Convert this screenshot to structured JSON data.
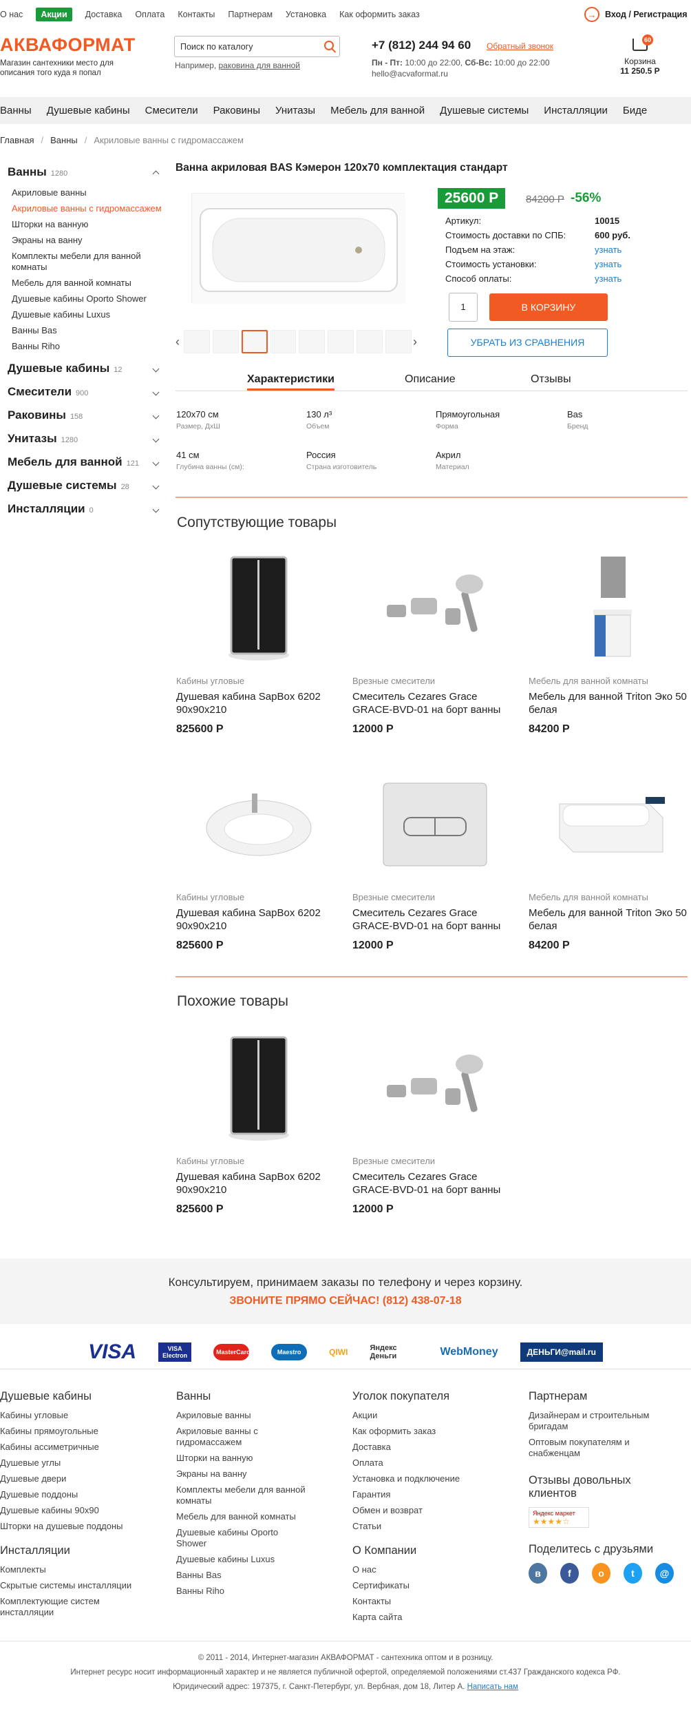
{
  "topnav": {
    "items": [
      "О нас",
      "Акции",
      "Доставка",
      "Оплата",
      "Контакты",
      "Партнерам",
      "Установка",
      "Как оформить заказ"
    ],
    "login": "Вход / Регистрация"
  },
  "header": {
    "logo": "АКВАФОРМАТ",
    "tagline": "Магазин сантехники место для описания того куда я попал",
    "search_placeholder": "Поиск по каталогу",
    "example_prefix": "Например, ",
    "example_link": "раковина для ванной",
    "phone": "+7 (812) 244 94 60",
    "callback": "Обратный звонок",
    "hours_weekday_label": "Пн - Пт:",
    "hours_weekday": "10:00 до 22:00,",
    "hours_weekend_label": "Сб-Вс:",
    "hours_weekend": "10:00 до 22:00",
    "email": "hello@acvaformat.ru",
    "cart_label": "Корзина",
    "cart_sum": "11 250.5 Р",
    "cart_count": "60"
  },
  "catnav": [
    "Ванны",
    "Душевые кабины",
    "Смесители",
    "Раковины",
    "Унитазы",
    "Мебель для ванной",
    "Душевые системы",
    "Инсталляции",
    "Биде"
  ],
  "breadcrumb": [
    "Главная",
    "Ванны",
    "Акриловые ванны с гидромассажем"
  ],
  "sidebar": [
    {
      "label": "Ванны",
      "count": "1280",
      "open": true,
      "subs": [
        "Акриловые ванны",
        "Акриловые ванны с гидромассажем",
        "Шторки на ванную",
        "Экраны на ванну",
        "Комплекты мебели для ванной комнаты",
        "Мебель для ванной комнаты",
        "Душевые кабины Oporto Shower",
        "Душевые кабины Luxus",
        "Ванны Bas",
        "Ванны Riho"
      ]
    },
    {
      "label": "Душевые кабины",
      "count": "12"
    },
    {
      "label": "Смесители",
      "count": "900"
    },
    {
      "label": "Раковины",
      "count": "158"
    },
    {
      "label": "Унитазы",
      "count": "1280"
    },
    {
      "label": "Мебель для ванной",
      "count": "121"
    },
    {
      "label": "Душевые системы",
      "count": "28"
    },
    {
      "label": "Инсталляции",
      "count": "0"
    }
  ],
  "product": {
    "title": "Ванна акриловая BAS Кэмерон 120x70 комплектация стандарт",
    "price": "25600 Р",
    "old_price": "84200 Р",
    "discount": "-56%",
    "specs": [
      {
        "k": "Артикул:",
        "v": "10015"
      },
      {
        "k": "Стоимость доставки по СПБ:",
        "v": "600 руб."
      },
      {
        "k": "Подъем на этаж:",
        "v": "узнать"
      },
      {
        "k": "Стоимость установки:",
        "v": "узнать"
      },
      {
        "k": "Способ оплаты:",
        "v": "узнать"
      }
    ],
    "qty": "1",
    "buy": "В КОРЗИНУ",
    "compare": "УБРАТЬ ИЗ СРАВНЕНИЯ",
    "tabs": [
      "Характеристики",
      "Описание",
      "Отзывы"
    ],
    "attrs": [
      {
        "v": "120x70 см",
        "l": "Размер, ДхШ"
      },
      {
        "v": "130 л³",
        "l": "Объем"
      },
      {
        "v": "Прямоугольная",
        "l": "Форма"
      },
      {
        "v": "Bas",
        "l": "Бренд"
      },
      {
        "v": "41 см",
        "l": "Глубина ванны (см):"
      },
      {
        "v": "Россия",
        "l": "Страна изготовитель"
      },
      {
        "v": "Акрил",
        "l": "Материал"
      }
    ]
  },
  "related": {
    "title": "Сопутствующие товары",
    "items": [
      {
        "cat": "Кабины угловые",
        "name": "Душевая кабина SapBox 6202 90x90x210",
        "price": "825600 Р"
      },
      {
        "cat": "Врезные смесители",
        "name": "Смеситель Cezares Grace GRACE-BVD-01 на борт ванны",
        "price": "12000 Р"
      },
      {
        "cat": "Мебель для ванной комнаты",
        "name": "Мебель для ванной Triton Эко 50 белая",
        "price": "84200 Р"
      },
      {
        "cat": "Кабины угловые",
        "name": "Душевая кабина SapBox 6202 90x90x210",
        "price": "825600 Р"
      },
      {
        "cat": "Врезные смесители",
        "name": "Смеситель Cezares Grace GRACE-BVD-01 на борт ванны",
        "price": "12000 Р"
      },
      {
        "cat": "Мебель для ванной комнаты",
        "name": "Мебель для ванной Triton Эко 50 белая",
        "price": "84200 Р"
      }
    ]
  },
  "similar": {
    "title": "Похожие товары",
    "items": [
      {
        "cat": "Кабины угловые",
        "name": "Душевая кабина SapBox 6202 90x90x210",
        "price": "825600 Р"
      },
      {
        "cat": "Врезные смесители",
        "name": "Смеситель Cezares Grace GRACE-BVD-01 на борт ванны",
        "price": "12000 Р"
      }
    ]
  },
  "consult": {
    "line1": "Консультируем, принимаем заказы по телефону и через корзину.",
    "line2": "ЗВОНИТЕ ПРЯМО СЕЙЧАС! (812) 438-07-18"
  },
  "payments": [
    "VISA",
    "VISA Electron",
    "MasterCard",
    "Maestro",
    "QIWI",
    "Яндекс Деньги",
    "WebMoney",
    "ДЕНЬГИ@mail.ru"
  ],
  "footer": {
    "col1": {
      "title": "Душевые кабины",
      "items": [
        "Кабины угловые",
        "Кабины прямоугольные",
        "Кабины ассиметричные",
        "Душевые углы",
        "Душевые двери",
        "Душевые поддоны",
        "Душевые кабины 90x90",
        "Шторки на душевые поддоны"
      ]
    },
    "col1b": {
      "title": "Инсталляции",
      "items": [
        "Комплекты",
        "Скрытые системы инсталляции",
        "Комплектующие систем инсталляции"
      ]
    },
    "col2": {
      "title": "Ванны",
      "items": [
        "Акриловые ванны",
        "Акриловые ванны с гидромассажем",
        "Шторки на ванную",
        "Экраны на ванну",
        "Комплекты мебели для ванной комнаты",
        "Мебель для ванной комнаты",
        "Душевые кабины Oporto Shower",
        "Душевые кабины Luxus",
        "Ванны Bas",
        "Ванны Riho"
      ]
    },
    "col3": {
      "title": "Уголок покупателя",
      "items": [
        "Акции",
        "Как оформить заказ",
        "Доставка",
        "Оплата",
        "Установка и подключение",
        "Гарантия",
        "Обмен и возврат",
        "Статьи"
      ]
    },
    "col3b": {
      "title": "О Компании",
      "items": [
        "О нас",
        "Сертификаты",
        "Контакты",
        "Карта сайта"
      ]
    },
    "col4": {
      "title": "Партнерам",
      "items": [
        "Дизайнерам и строительным бригадам",
        "Оптовым покупателям и снабженцам"
      ]
    },
    "reviews": "Отзывы довольных клиентов",
    "market": "Яндекс маркет",
    "share": "Поделитесь с друзьями",
    "copy1": "© 2011 - 2014, Интернет-магазин АКВАФОРМАТ - сантехника оптом и в розницу.",
    "copy2": "Интернет ресурс носит информационный характер и не является публичной офертой, определяемой положениями ст.437 Гражданского кодекса РФ.",
    "address": "Юридический адрес: 197375, г. Санкт-Петербург, ул. Вербная, дом 18, Литер А.",
    "write": "Написать нам"
  }
}
